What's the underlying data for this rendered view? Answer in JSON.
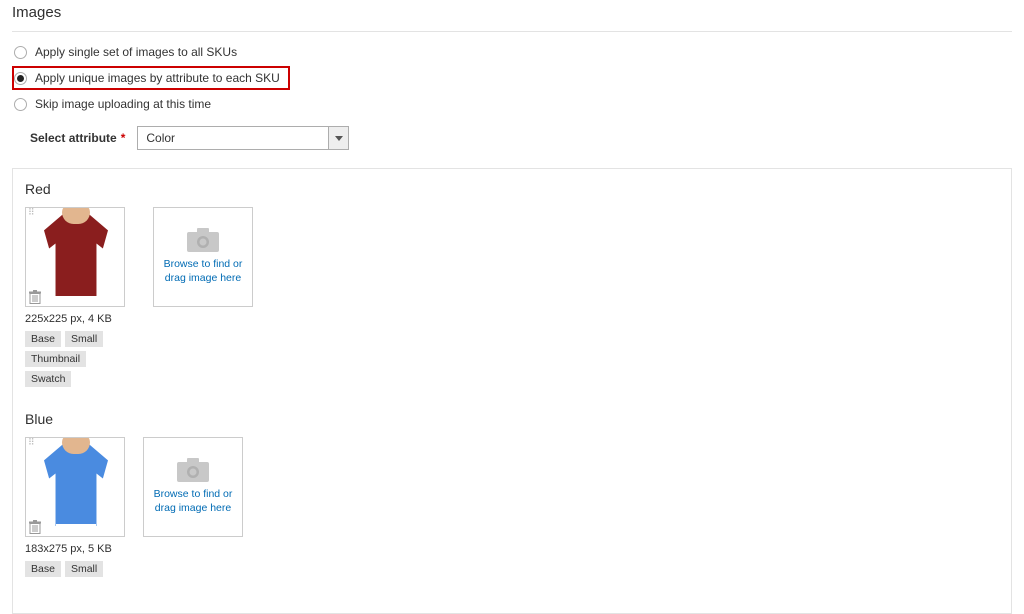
{
  "section_title": "Images",
  "radios": {
    "opt1": "Apply single set of images to all SKUs",
    "opt2": "Apply unique images by attribute to each SKU",
    "opt3": "Skip image uploading at this time",
    "selected": "opt2"
  },
  "attribute": {
    "label": "Select attribute",
    "required": "*",
    "value": "Color"
  },
  "upload_text": "Browse to find or drag image here",
  "variants": [
    {
      "title": "Red",
      "meta": "225x225 px, 4 KB",
      "tags": [
        "Base",
        "Small",
        "Thumbnail",
        "Swatch"
      ],
      "shirt": "red"
    },
    {
      "title": "Blue",
      "meta": "183x275 px, 5 KB",
      "tags": [
        "Base",
        "Small"
      ],
      "shirt": "blue"
    }
  ]
}
